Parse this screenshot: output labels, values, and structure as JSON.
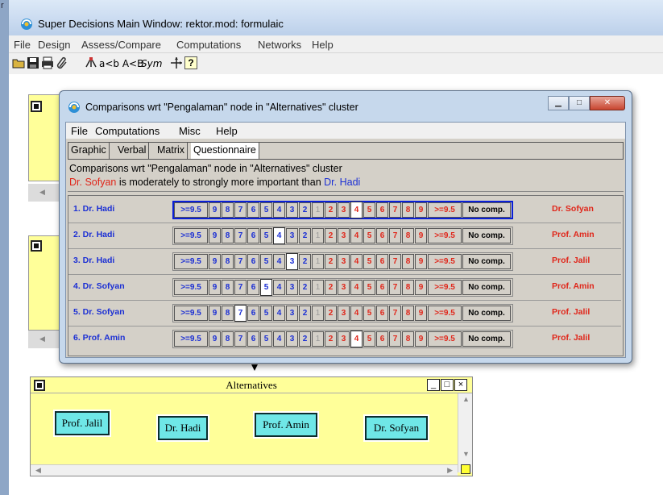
{
  "main_window": {
    "title": "Super Decisions Main Window: rektor.mod: formulaic",
    "left_strip_char": "r",
    "menu": [
      "File",
      "Design",
      "Assess/Compare",
      "Computations",
      "Networks",
      "Help"
    ],
    "toolbar": {
      "text_relations": "a<b A<B",
      "text_sym": "Sym",
      "help_glyph": "?"
    }
  },
  "dialog": {
    "title": "Comparisons wrt \"Pengalaman\" node in \"Alternatives\" cluster",
    "menu": [
      "File",
      "Computations",
      "Misc",
      "Help"
    ],
    "tabs": [
      "Graphic",
      "Verbal",
      "Matrix",
      "Questionnaire"
    ],
    "active_tab": "Questionnaire",
    "info_line1": "Comparisons wrt \"Pengalaman\" node in \"Alternatives\" cluster",
    "info_line2": {
      "left_node": "Dr. Sofyan",
      "phrase": " is moderately to strongly more important than ",
      "right_node": "Dr. Hadi"
    },
    "scale_left": [
      ">=9.5",
      "9",
      "8",
      "7",
      "6",
      "5",
      "4",
      "3",
      "2"
    ],
    "scale_mid": "1",
    "scale_right": [
      "2",
      "3",
      "4",
      "5",
      "6",
      "7",
      "8",
      "9",
      ">=9.5"
    ],
    "no_comp_label": "No comp.",
    "rows": [
      {
        "num": "1.",
        "left": "Dr. Hadi",
        "right": "Dr. Sofyan",
        "side": "right",
        "value": "4"
      },
      {
        "num": "2.",
        "left": "Dr. Hadi",
        "right": "Prof. Amin",
        "side": "left",
        "value": "4"
      },
      {
        "num": "3.",
        "left": "Dr. Hadi",
        "right": "Prof. Jalil",
        "side": "left",
        "value": "3"
      },
      {
        "num": "4.",
        "left": "Dr. Sofyan",
        "right": "Prof. Amin",
        "side": "left",
        "value": "5"
      },
      {
        "num": "5.",
        "left": "Dr. Sofyan",
        "right": "Prof. Jalil",
        "side": "left",
        "value": "7"
      },
      {
        "num": "6.",
        "left": "Prof. Amin",
        "right": "Prof. Jalil",
        "side": "right",
        "value": "4"
      }
    ]
  },
  "alternatives_cluster": {
    "title": "Alternatives",
    "controls": [
      "_",
      "□",
      "×"
    ],
    "nodes": [
      "Prof. Jalil",
      "Dr. Hadi",
      "Prof. Amin",
      "Dr. Sofyan"
    ]
  },
  "colors": {
    "cluster_bg": "#ffff99",
    "node_bg": "#6fe7e7",
    "left_node_color": "#1b2fd4",
    "right_node_color": "#e0261a",
    "dialog_bg": "#c6d8ec",
    "focus_border": "#0a1fd6"
  }
}
